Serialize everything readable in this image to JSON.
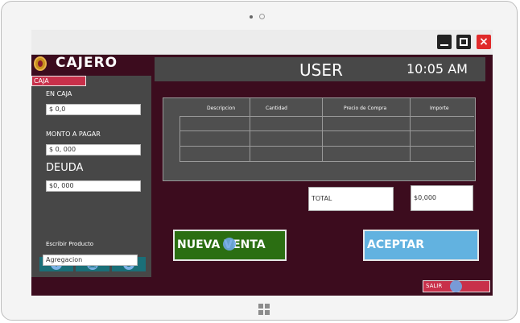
{
  "app": {
    "title": "CAJERO"
  },
  "sidebar": {
    "tab": "CAJA",
    "en_caja_label": "EN CAJA",
    "en_caja_value": "$ 0,0",
    "monto_label": "MONTO A PAGAR",
    "monto_value": "$ 0, 000",
    "deuda_label": "DEUDA",
    "deuda_value": "$0, 000",
    "buttons": [
      {
        "icon": "plus-icon",
        "glyph": "+"
      },
      {
        "icon": "square-icon",
        "glyph": "▣"
      },
      {
        "icon": "close-circle-icon",
        "glyph": "⊗"
      }
    ],
    "producto_label": "Escribir Producto",
    "producto_value": "Agregacion"
  },
  "header": {
    "user": "USER",
    "time": "10:05 AM"
  },
  "table": {
    "columns": [
      "Descripcion",
      "Cantidad",
      "Precio de Compra",
      "Importe"
    ]
  },
  "totals": {
    "label": "TOTAL",
    "value": "$0,000"
  },
  "actions": {
    "nueva_venta": "NUEVA VENTA",
    "aceptar": "ACEPTAR",
    "salir": "SALIR"
  },
  "colors": {
    "background": "#3c0c1e",
    "accent": "#c8304a",
    "green": "#2b6e12",
    "blue": "#62b2e0",
    "teal": "#1a6f78"
  }
}
